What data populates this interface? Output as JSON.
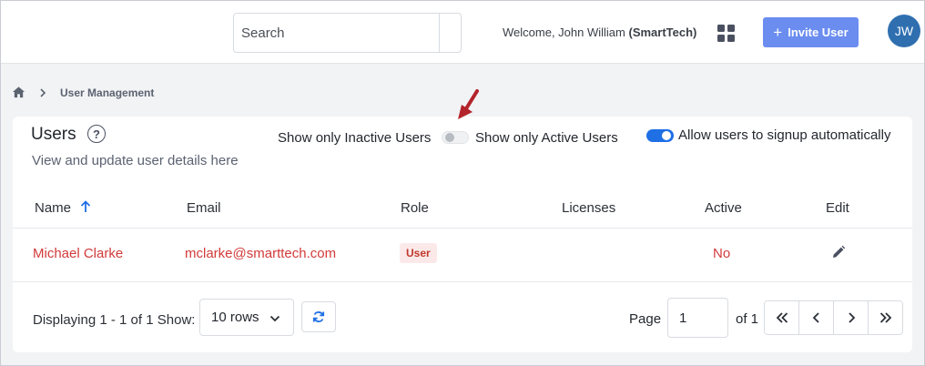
{
  "header": {
    "search_placeholder": "Search",
    "welcome_prefix": "Welcome, John William",
    "welcome_org": "(SmartTech)",
    "invite_label": "Invite User",
    "avatar_initials": "JW"
  },
  "breadcrumb": {
    "current": "User Management"
  },
  "card": {
    "title": "Users",
    "subtitle": "View and update user details here",
    "toggle_inactive_label": "Show only Inactive Users",
    "toggle_active_label": "Show only Active Users",
    "active_toggle_state": "off",
    "signup_label": "Allow users to signup automatically",
    "signup_toggle_state": "on"
  },
  "table": {
    "headers": {
      "name": "Name",
      "email": "Email",
      "role": "Role",
      "licenses": "Licenses",
      "active": "Active",
      "edit": "Edit"
    },
    "rows": [
      {
        "name": "Michael Clarke",
        "email": "mclarke@smarttech.com",
        "role": "User",
        "licenses": "",
        "active": "No"
      }
    ]
  },
  "footer": {
    "displaying": "Displaying 1 - 1 of 1",
    "show_label": "Show:",
    "rows_value": "10 rows",
    "page_label": "Page",
    "page_value": "1",
    "of_label": "of 1"
  },
  "colors": {
    "accent": "#1f6fe5",
    "invite_button": "#6b8df0",
    "inactive_text": "#d23a3a",
    "avatar": "#2f6fb0"
  }
}
